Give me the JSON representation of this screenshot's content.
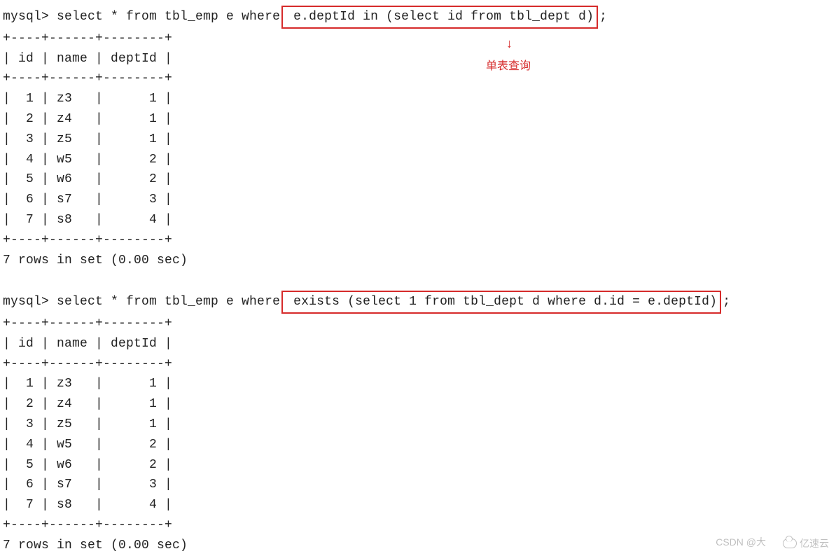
{
  "prompt": "mysql> ",
  "query1": {
    "prefix": "select * from tbl_emp e where",
    "boxed": " e.deptId in (select id from tbl_dept d)",
    "suffix": ";"
  },
  "annotation": {
    "arrow": "↓",
    "text": "单表查询"
  },
  "divider": "+----+------+--------+",
  "header": "| id | name | deptId |",
  "rows1": [
    "|  1 | z3   |      1 |",
    "|  2 | z4   |      1 |",
    "|  3 | z5   |      1 |",
    "|  4 | w5   |      2 |",
    "|  5 | w6   |      2 |",
    "|  6 | s7   |      3 |",
    "|  7 | s8   |      4 |"
  ],
  "result1": "7 rows in set (0.00 sec)",
  "query2": {
    "prefix": "select * from tbl_emp e where",
    "boxed": " exists (select 1 from tbl_dept d where d.id = e.deptId)",
    "suffix": ";"
  },
  "rows2": [
    "|  1 | z3   |      1 |",
    "|  2 | z4   |      1 |",
    "|  3 | z5   |      1 |",
    "|  4 | w5   |      2 |",
    "|  5 | w6   |      2 |",
    "|  6 | s7   |      3 |",
    "|  7 | s8   |      4 |"
  ],
  "result2": "7 rows in set (0.00 sec)",
  "watermark1": "CSDN @大",
  "watermark2": "亿速云",
  "chart_data": {
    "type": "table",
    "columns": [
      "id",
      "name",
      "deptId"
    ],
    "query1_sql": "select * from tbl_emp e where e.deptId in (select id from tbl_dept d);",
    "query1_rows": [
      {
        "id": 1,
        "name": "z3",
        "deptId": 1
      },
      {
        "id": 2,
        "name": "z4",
        "deptId": 1
      },
      {
        "id": 3,
        "name": "z5",
        "deptId": 1
      },
      {
        "id": 4,
        "name": "w5",
        "deptId": 2
      },
      {
        "id": 5,
        "name": "w6",
        "deptId": 2
      },
      {
        "id": 6,
        "name": "s7",
        "deptId": 3
      },
      {
        "id": 7,
        "name": "s8",
        "deptId": 4
      }
    ],
    "query1_summary": "7 rows in set (0.00 sec)",
    "query2_sql": "select * from tbl_emp e where exists (select 1 from tbl_dept d where d.id = e.deptId);",
    "query2_rows": [
      {
        "id": 1,
        "name": "z3",
        "deptId": 1
      },
      {
        "id": 2,
        "name": "z4",
        "deptId": 1
      },
      {
        "id": 3,
        "name": "z5",
        "deptId": 1
      },
      {
        "id": 4,
        "name": "w5",
        "deptId": 2
      },
      {
        "id": 5,
        "name": "w6",
        "deptId": 2
      },
      {
        "id": 6,
        "name": "s7",
        "deptId": 3
      },
      {
        "id": 7,
        "name": "s8",
        "deptId": 4
      }
    ],
    "query2_summary": "7 rows in set (0.00 sec)",
    "annotation": "单表查询"
  }
}
